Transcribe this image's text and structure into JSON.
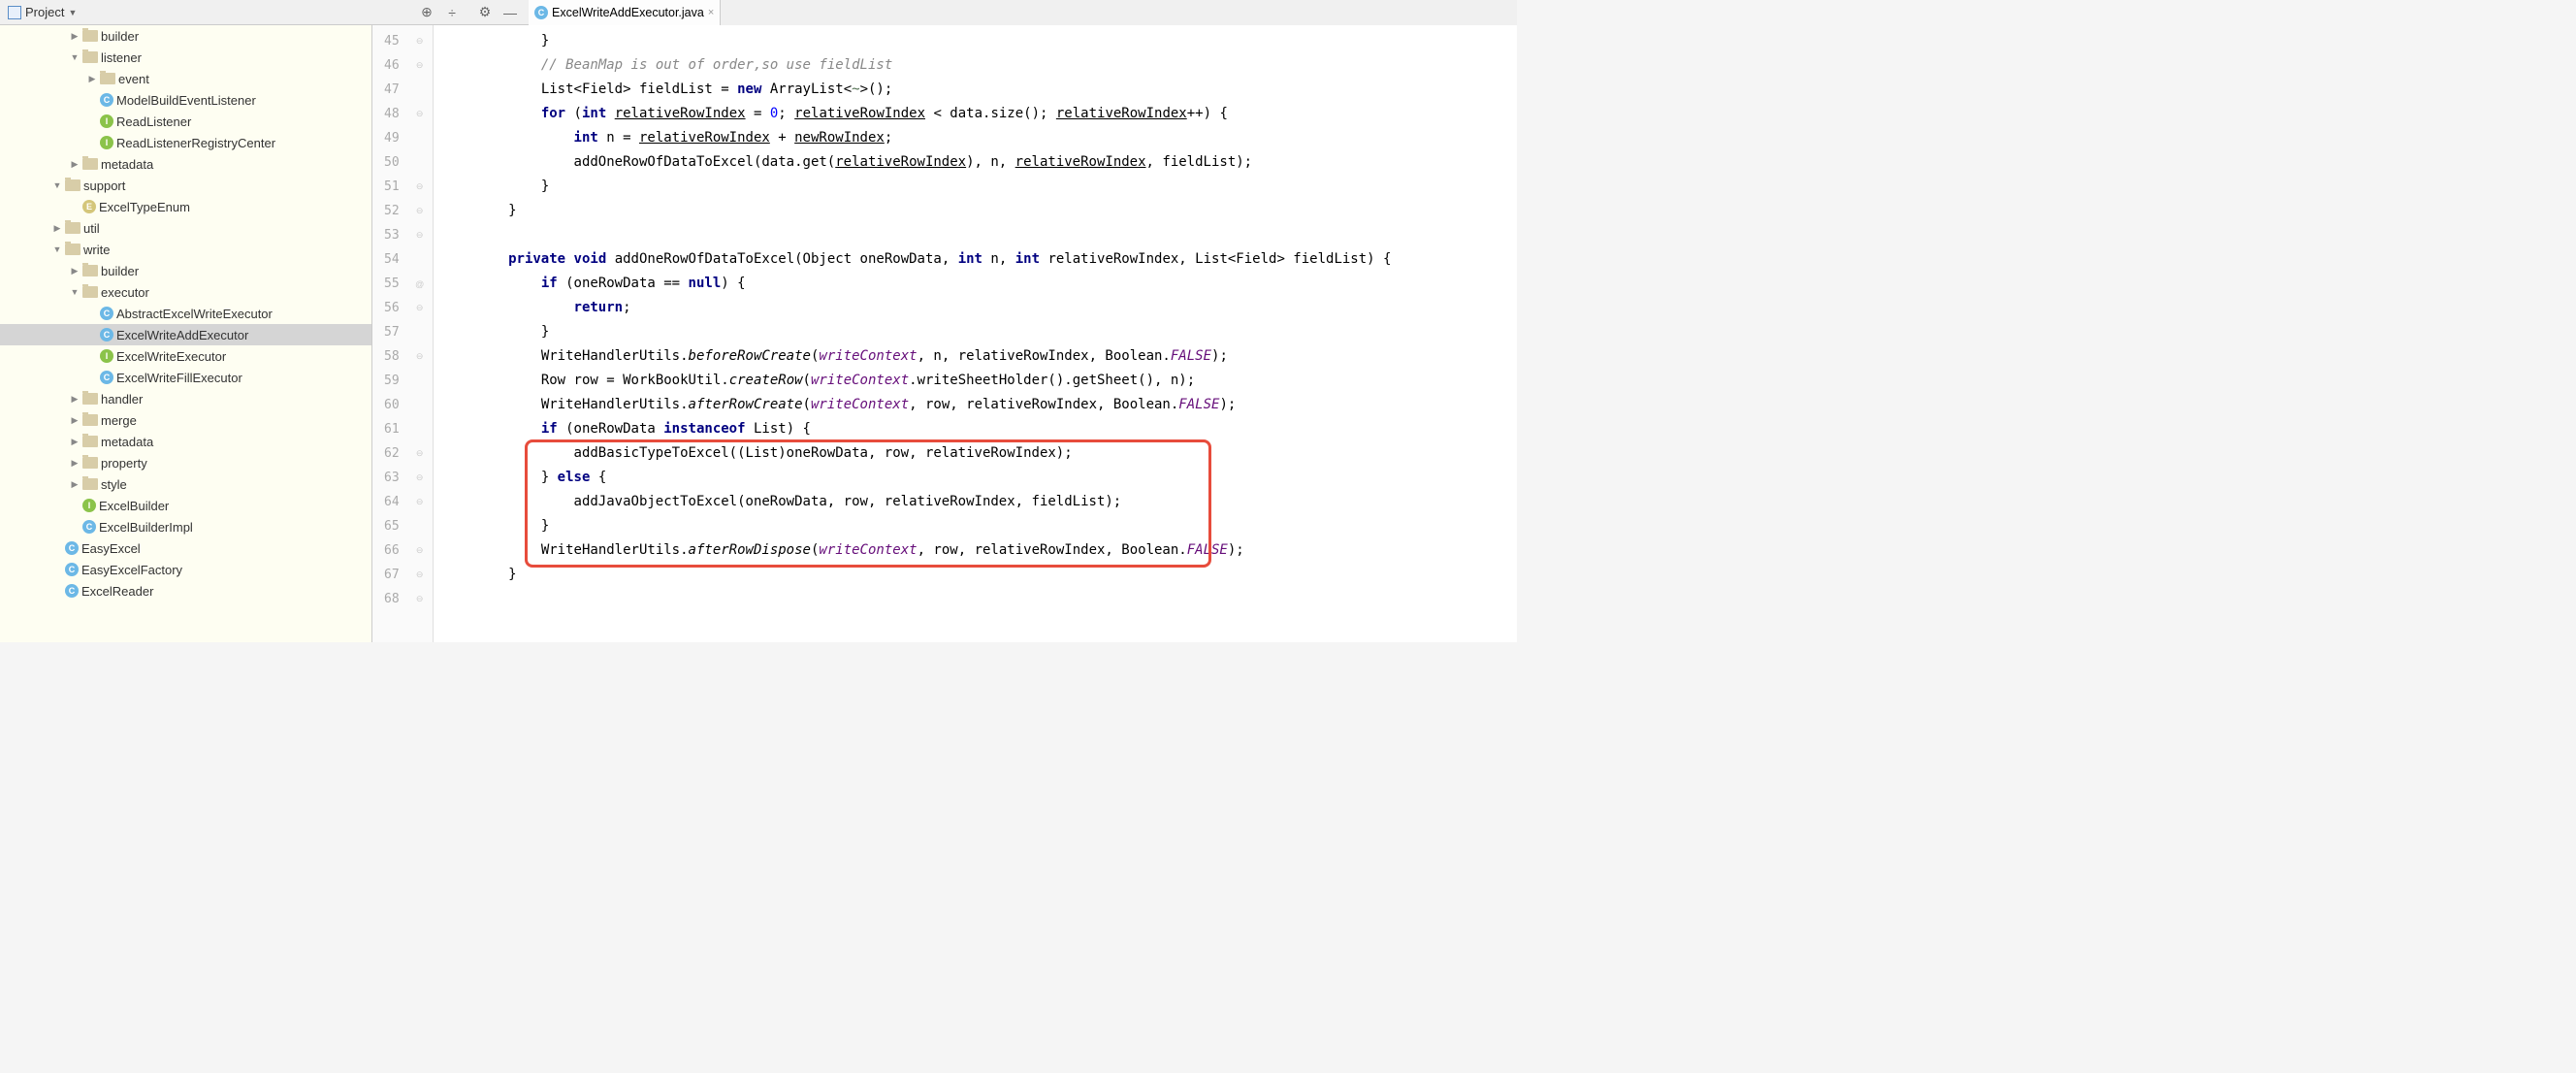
{
  "toolbar": {
    "projectLabel": "Project"
  },
  "tab": {
    "fileName": "ExcelWriteAddExecutor.java",
    "iconLetter": "C"
  },
  "tree": [
    {
      "indent": 4,
      "arrow": "collapsed",
      "icon": "folder",
      "label": "builder"
    },
    {
      "indent": 4,
      "arrow": "expanded",
      "icon": "folder",
      "label": "listener"
    },
    {
      "indent": 5,
      "arrow": "collapsed",
      "icon": "folder",
      "label": "event"
    },
    {
      "indent": 5,
      "arrow": "leaf",
      "icon": "class-c",
      "label": "ModelBuildEventListener"
    },
    {
      "indent": 5,
      "arrow": "leaf",
      "icon": "class-i",
      "label": "ReadListener"
    },
    {
      "indent": 5,
      "arrow": "leaf",
      "icon": "class-i",
      "label": "ReadListenerRegistryCenter"
    },
    {
      "indent": 4,
      "arrow": "collapsed",
      "icon": "folder",
      "label": "metadata"
    },
    {
      "indent": 3,
      "arrow": "expanded",
      "icon": "folder",
      "label": "support"
    },
    {
      "indent": 4,
      "arrow": "leaf",
      "icon": "class-e",
      "label": "ExcelTypeEnum"
    },
    {
      "indent": 3,
      "arrow": "collapsed",
      "icon": "folder",
      "label": "util"
    },
    {
      "indent": 3,
      "arrow": "expanded",
      "icon": "folder",
      "label": "write"
    },
    {
      "indent": 4,
      "arrow": "collapsed",
      "icon": "folder",
      "label": "builder"
    },
    {
      "indent": 4,
      "arrow": "expanded",
      "icon": "folder",
      "label": "executor"
    },
    {
      "indent": 5,
      "arrow": "leaf",
      "icon": "class-c",
      "label": "AbstractExcelWriteExecutor"
    },
    {
      "indent": 5,
      "arrow": "leaf",
      "icon": "class-c",
      "label": "ExcelWriteAddExecutor",
      "selected": true
    },
    {
      "indent": 5,
      "arrow": "leaf",
      "icon": "class-i",
      "label": "ExcelWriteExecutor"
    },
    {
      "indent": 5,
      "arrow": "leaf",
      "icon": "class-c",
      "label": "ExcelWriteFillExecutor"
    },
    {
      "indent": 4,
      "arrow": "collapsed",
      "icon": "folder",
      "label": "handler"
    },
    {
      "indent": 4,
      "arrow": "collapsed",
      "icon": "folder",
      "label": "merge"
    },
    {
      "indent": 4,
      "arrow": "collapsed",
      "icon": "folder",
      "label": "metadata"
    },
    {
      "indent": 4,
      "arrow": "collapsed",
      "icon": "folder",
      "label": "property"
    },
    {
      "indent": 4,
      "arrow": "collapsed",
      "icon": "folder",
      "label": "style"
    },
    {
      "indent": 4,
      "arrow": "leaf",
      "icon": "class-i",
      "label": "ExcelBuilder"
    },
    {
      "indent": 4,
      "arrow": "leaf",
      "icon": "class-c",
      "label": "ExcelBuilderImpl"
    },
    {
      "indent": 3,
      "arrow": "leaf",
      "icon": "class-c",
      "label": "EasyExcel"
    },
    {
      "indent": 3,
      "arrow": "leaf",
      "icon": "class-c",
      "label": "EasyExcelFactory"
    },
    {
      "indent": 3,
      "arrow": "leaf",
      "icon": "class-c",
      "label": "ExcelReader"
    }
  ],
  "lines": {
    "start": 45,
    "end": 68
  },
  "gutterMarks": {
    "55": "@"
  },
  "code": {
    "l45": {
      "indent": "            ",
      "brace": "}"
    },
    "l46": {
      "indent": "            ",
      "comment": "// BeanMap is out of order,so use fieldList"
    },
    "l47": {
      "indent": "            ",
      "text1": "List<Field> fieldList = ",
      "kw": "new",
      "text2": " ArrayList<",
      "tp": "~",
      "text3": ">();"
    },
    "l48": {
      "indent": "            ",
      "kw1": "for",
      "text1": " (",
      "kw2": "int",
      "text2": " ",
      "u1": "relativeRowIndex",
      "text3": " = ",
      "num": "0",
      "text4": "; ",
      "u2": "relativeRowIndex",
      "text5": " < data.size(); ",
      "u3": "relativeRowIndex",
      "text6": "++) {"
    },
    "l49": {
      "indent": "                ",
      "kw": "int",
      "text1": " n = ",
      "u1": "relativeRowIndex",
      "text2": " + ",
      "u2": "newRowIndex",
      "text3": ";"
    },
    "l50": {
      "indent": "                ",
      "text1": "addOneRowOfDataToExcel(data.get(",
      "u1": "relativeRowIndex",
      "text2": "), n, ",
      "u2": "relativeRowIndex",
      "text3": ", fieldList);"
    },
    "l51": {
      "indent": "            ",
      "brace": "}"
    },
    "l52": {
      "indent": "        ",
      "brace": "}"
    },
    "l53": {
      "indent": "",
      "empty": ""
    },
    "l54": {
      "indent": "        ",
      "kw1": "private",
      "kw2": "void",
      "text1": " addOneRowOfDataToExcel(Object oneRowData, ",
      "kw3": "int",
      "text2": " n, ",
      "kw4": "int",
      "text3": " relativeRowIndex, List<Field> fieldList) {"
    },
    "l55": {
      "indent": "            ",
      "kw": "if",
      "text1": " (oneRowData == ",
      "kw2": "null",
      "text2": ") {"
    },
    "l56": {
      "indent": "                ",
      "kw": "return",
      "text": ";"
    },
    "l57": {
      "indent": "            ",
      "brace": "}"
    },
    "l58": {
      "indent": "            ",
      "text1": "WriteHandlerUtils.",
      "it1": "beforeRowCreate",
      "text2": "(",
      "field": "writeContext",
      "text3": ", n, relativeRowIndex, Boolean.",
      "it2": "FALSE",
      "text4": ");"
    },
    "l59": {
      "indent": "            ",
      "text1": "Row row = WorkBookUtil.",
      "it1": "createRow",
      "text2": "(",
      "field": "writeContext",
      "text3": ".writeSheetHolder().getSheet(), n);"
    },
    "l60": {
      "indent": "            ",
      "text1": "WriteHandlerUtils.",
      "it1": "afterRowCreate",
      "text2": "(",
      "field": "writeContext",
      "text3": ", row, relativeRowIndex, Boolean.",
      "it2": "FALSE",
      "text4": ");"
    },
    "l61": {
      "indent": "            ",
      "kw": "if",
      "text1": " (oneRowData ",
      "kw2": "instanceof",
      "text2": " List) {"
    },
    "l62": {
      "indent": "                ",
      "text": "addBasicTypeToExcel((List)oneRowData, row, relativeRowIndex);"
    },
    "l63": {
      "indent": "            ",
      "text1": "} ",
      "kw": "else",
      "text2": " {"
    },
    "l64": {
      "indent": "                ",
      "text": "addJavaObjectToExcel(oneRowData, row, relativeRowIndex, fieldList);"
    },
    "l65": {
      "indent": "            ",
      "brace": "}"
    },
    "l66": {
      "indent": "            ",
      "text1": "WriteHandlerUtils.",
      "it1": "afterRowDispose",
      "text2": "(",
      "field": "writeContext",
      "text3": ", row, relativeRowIndex, Boolean.",
      "it2": "FALSE",
      "text4": ");"
    },
    "l67": {
      "indent": "        ",
      "brace": "}"
    }
  }
}
